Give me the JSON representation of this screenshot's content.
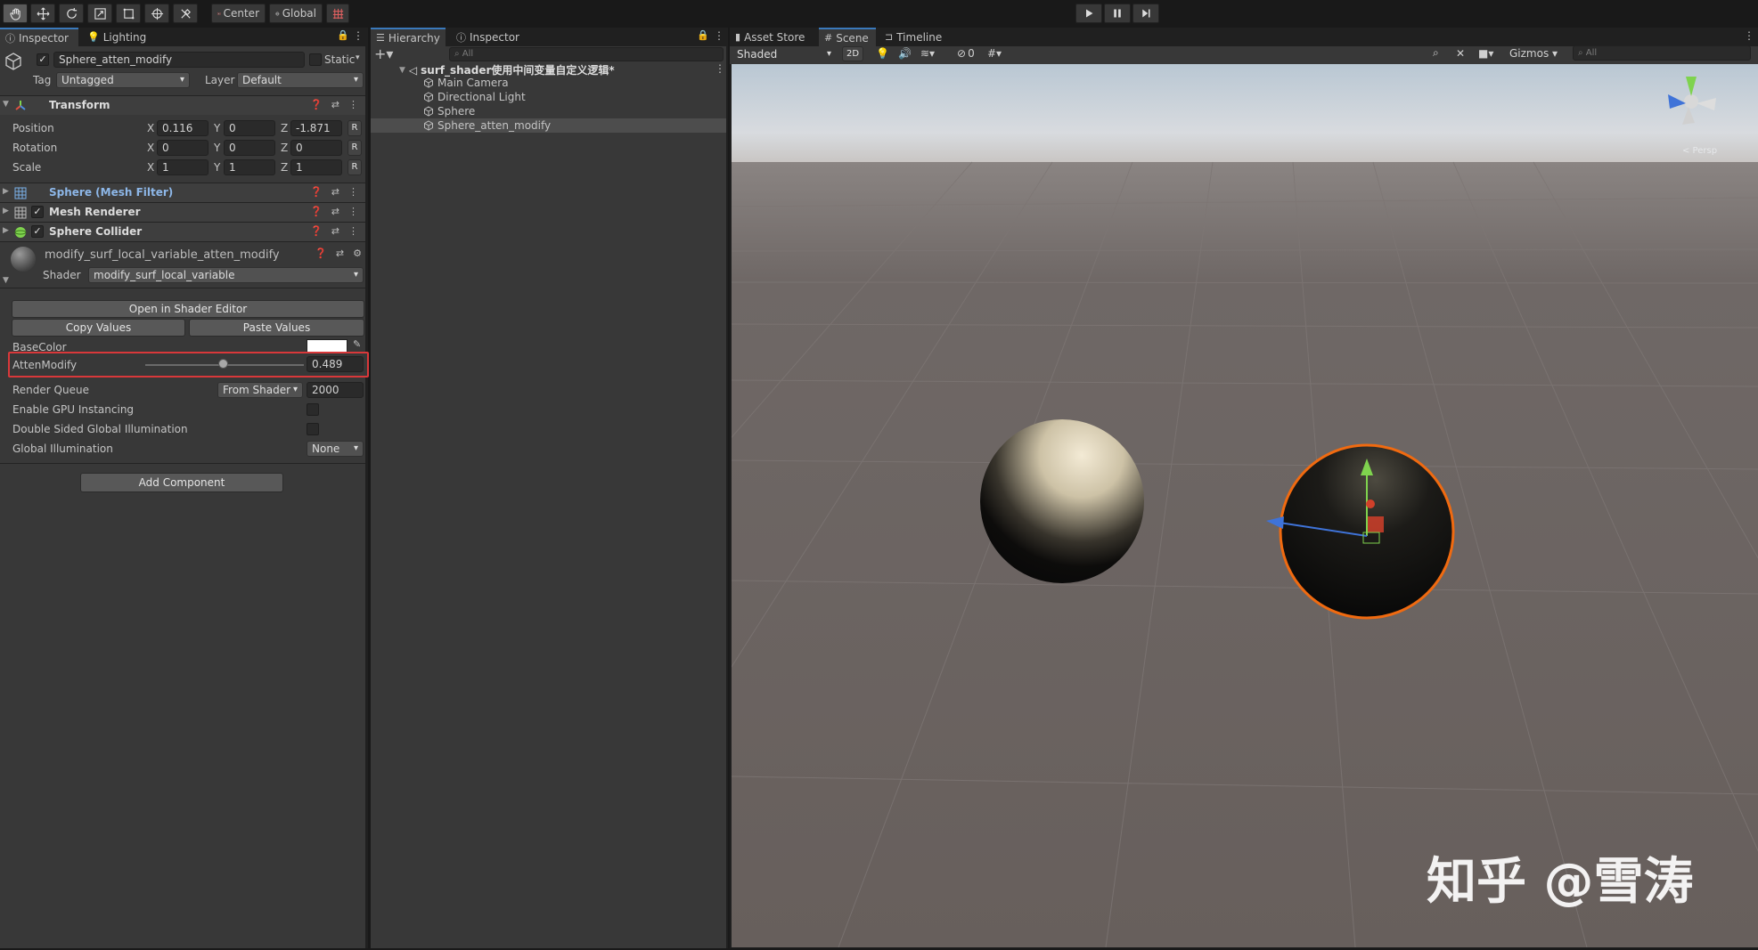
{
  "toolbar": {
    "pivot_label": "Center",
    "space_label": "Global"
  },
  "inspector": {
    "tabs": [
      "Inspector",
      "Lighting"
    ],
    "object_name": "Sphere_atten_modify",
    "static_label": "Static",
    "tag_label": "Tag",
    "tag_value": "Untagged",
    "layer_label": "Layer",
    "layer_value": "Default",
    "transform": {
      "title": "Transform",
      "position_label": "Position",
      "rotation_label": "Rotation",
      "scale_label": "Scale",
      "position": {
        "x": "0.116",
        "y": "0",
        "z": "-1.871"
      },
      "rotation": {
        "x": "0",
        "y": "0",
        "z": "0"
      },
      "scale": {
        "x": "1",
        "y": "1",
        "z": "1"
      },
      "reset_label": "R"
    },
    "components": [
      {
        "name": "Sphere (Mesh Filter)"
      },
      {
        "name": "Mesh Renderer"
      },
      {
        "name": "Sphere Collider"
      }
    ],
    "material": {
      "name": "modify_surf_local_variable_atten_modify",
      "shader_label": "Shader",
      "shader_value": "modify_surf_local_variable",
      "open_editor_label": "Open in Shader Editor",
      "copy_label": "Copy Values",
      "paste_label": "Paste Values",
      "basecolor_label": "BaseColor",
      "atten_label": "AttenModify",
      "atten_value": "0.489",
      "atten_fraction": 0.489,
      "render_queue_label": "Render Queue",
      "render_queue_mode": "From Shader",
      "render_queue_value": "2000",
      "gpu_instancing_label": "Enable GPU Instancing",
      "double_sided_label": "Double Sided Global Illumination",
      "global_illum_label": "Global Illumination",
      "global_illum_value": "None"
    },
    "add_component_label": "Add Component"
  },
  "hierarchy": {
    "tabs": [
      "Hierarchy",
      "Inspector"
    ],
    "search_placeholder": "All",
    "scene_name": "surf_shader使用中间变量自定义逻辑*",
    "items": [
      "Main Camera",
      "Directional Light",
      "Sphere",
      "Sphere_atten_modify"
    ]
  },
  "scene": {
    "tabs": [
      "Asset Store",
      "Scene",
      "Timeline"
    ],
    "shading_mode": "Shaded",
    "mode_2d": "2D",
    "hidden_count": "0",
    "gizmos_label": "Gizmos",
    "search_placeholder": "All",
    "persp_label": "< Persp",
    "watermark": "知乎 @雪涛"
  },
  "colors": {
    "accent": "#3a79bb",
    "highlight_box": "#d9383a",
    "selection_outline": "#f06a10"
  }
}
